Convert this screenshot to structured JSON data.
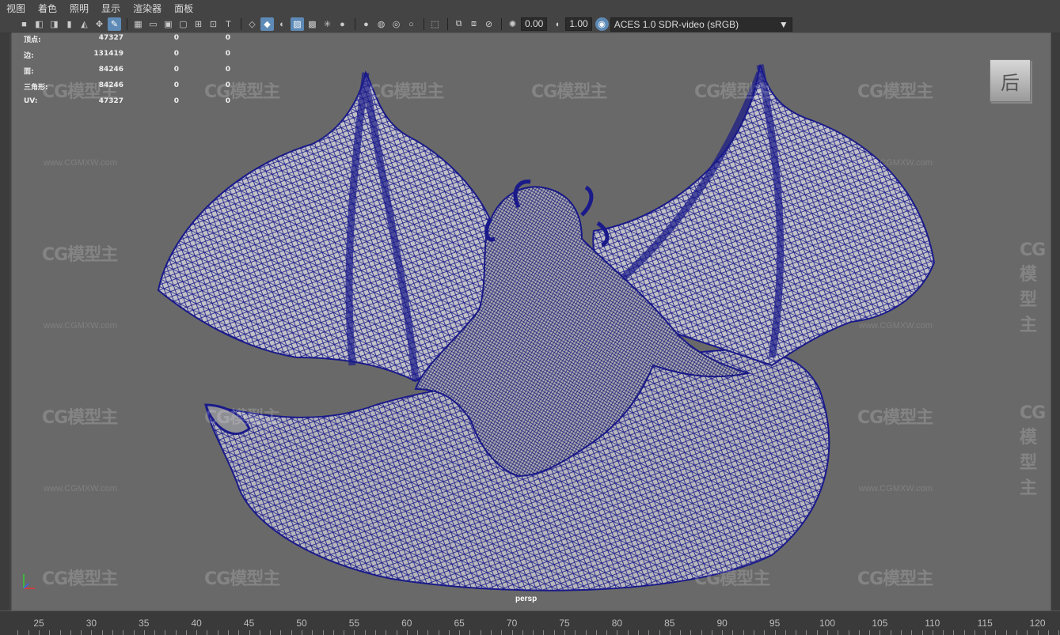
{
  "menu": [
    "视图",
    "着色",
    "照明",
    "显示",
    "渲染器",
    "面板"
  ],
  "toolbar": {
    "field1": "0.00",
    "field2": "1.00",
    "colorspace": "ACES 1.0 SDR-video (sRGB)"
  },
  "hud": [
    {
      "label": "顶点:",
      "v1": "47327",
      "v2": "0",
      "v3": "0"
    },
    {
      "label": "边:",
      "v1": "131419",
      "v2": "0",
      "v3": "0"
    },
    {
      "label": "面:",
      "v1": "84246",
      "v2": "0",
      "v3": "0"
    },
    {
      "label": "三角形:",
      "v1": "84246",
      "v2": "0",
      "v3": "0"
    },
    {
      "label": "UV:",
      "v1": "47327",
      "v2": "0",
      "v3": "0"
    }
  ],
  "viewcube_label": "后",
  "camera_name": "persp",
  "watermark": {
    "brand": "CG模型主",
    "url": "www.CGMXW.com"
  },
  "timeline_ticks": [
    "25",
    "30",
    "35",
    "40",
    "45",
    "50",
    "55",
    "60",
    "65",
    "70",
    "75",
    "80",
    "85",
    "90",
    "95",
    "100",
    "105",
    "110",
    "115",
    "120"
  ],
  "colors": {
    "wire": "#1a1a8a",
    "viewport_bg": "#696969",
    "accent": "#5d8ab6"
  }
}
